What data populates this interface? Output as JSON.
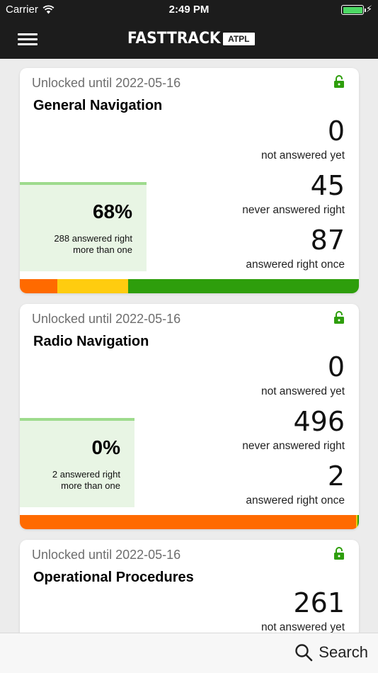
{
  "status_bar": {
    "carrier": "Carrier",
    "time": "2:49 PM"
  },
  "header": {
    "brand": "FASTTRACK",
    "badge": "ATPL"
  },
  "cards": [
    {
      "unlocked": "Unlocked until 2022-05-16",
      "subject": "General Navigation",
      "not_answered": {
        "value": "0",
        "label": "not answered yet"
      },
      "never_right": {
        "value": "45",
        "label": "never answered right"
      },
      "right_once": {
        "value": "87",
        "label": "answered right once"
      },
      "percent": "68%",
      "more_than_one_1": "288 answered right",
      "more_than_one_2": "more than one",
      "progress_fraction": 0.68,
      "segments": [
        {
          "fraction": 0.11,
          "color": "#ff6a00"
        },
        {
          "fraction": 0.21,
          "color": "#ffcc0f"
        },
        {
          "fraction": 0.68,
          "color": "#2e9e0c"
        }
      ]
    },
    {
      "unlocked": "Unlocked until 2022-05-16",
      "subject": "Radio Navigation",
      "not_answered": {
        "value": "0",
        "label": "not answered yet"
      },
      "never_right": {
        "value": "496",
        "label": "never answered right"
      },
      "right_once": {
        "value": "2",
        "label": "answered right once"
      },
      "percent": "0%",
      "more_than_one_1": "2 answered right",
      "more_than_one_2": "more than one",
      "progress_fraction": 0.0,
      "segments": [
        {
          "fraction": 0.992,
          "color": "#ff6a00"
        },
        {
          "fraction": 0.004,
          "color": "#ffcc0f"
        },
        {
          "fraction": 0.004,
          "color": "#2e9e0c"
        }
      ]
    },
    {
      "unlocked": "Unlocked until 2022-05-16",
      "subject": "Operational Procedures",
      "not_answered": {
        "value": "261",
        "label": "not answered yet"
      }
    }
  ],
  "bottom_bar": {
    "search_label": "Search"
  },
  "colors": {
    "header_bg": "#1c1c1c",
    "lock_green": "#2e9e0c",
    "battery_green": "#4cd964"
  }
}
